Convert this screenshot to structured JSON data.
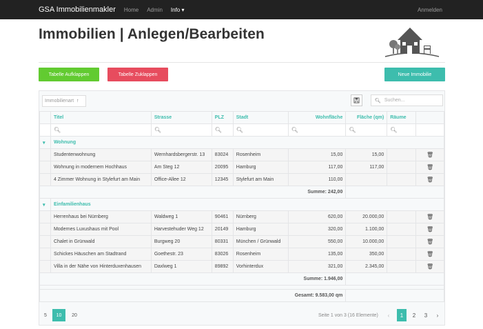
{
  "navbar": {
    "brand": "GSA Immobilienmakler",
    "links": [
      "Home",
      "Admin",
      "Info ▾"
    ],
    "login": "Anmelden"
  },
  "page": {
    "title": "Immobilien | Anlegen/Bearbeiten"
  },
  "buttons": {
    "expand": "Tabelle Aufklappen",
    "collapse": "Tabelle Zuklappen",
    "new": "Neue Immobilie"
  },
  "toolbar": {
    "group_sort": "Immobilienart",
    "group_sort_icon": "↑",
    "export_icon": "save-icon",
    "search_placeholder": "Suchen..."
  },
  "table": {
    "columns": [
      "Titel",
      "Strasse",
      "PLZ",
      "Stadt",
      "Wohnfläche",
      "Fläche (qm)",
      "Räume"
    ],
    "groups": [
      {
        "name": "Wohnung",
        "rows": [
          [
            "Studentenwohnung",
            "Wernhardsbergerstr. 13",
            "83024",
            "Rosenheim",
            "15,00",
            "15,00",
            ""
          ],
          [
            "Wohnung in modernem Hochhaus",
            "Am Steg 12",
            "20095",
            "Hamburg",
            "117,00",
            "117,00",
            ""
          ],
          [
            "4 Zimmer Wohnung in Stylefurt am Main",
            "Office-Allee 12",
            "12345",
            "Stylefurt am Main",
            "110,00",
            "",
            ""
          ]
        ],
        "sum": "Summe: 242,00"
      },
      {
        "name": "Einfamilienhaus",
        "rows": [
          [
            "Herrenhaus bei Nürnberg",
            "Waldweg 1",
            "90461",
            "Nürnberg",
            "620,00",
            "20.000,00",
            ""
          ],
          [
            "Modernes Luxushaus mit Pool",
            "Harvestehuder Weg 12",
            "20149",
            "Hamburg",
            "320,00",
            "1.100,00",
            ""
          ],
          [
            "Chalet in Grünwald",
            "Burgweg 20",
            "80331",
            "München / Grünwald",
            "550,00",
            "10.000,00",
            ""
          ],
          [
            "Schickes Häuschen am Stadtrand",
            "Goethestr. 23",
            "83026",
            "Rosenheim",
            "135,00",
            "350,00",
            ""
          ],
          [
            "Villa in der Nähe von Hinterduxenhausen",
            "Daxlweg 1",
            "89892",
            "Vorhinterdux",
            "321,00",
            "2.345,00",
            ""
          ]
        ],
        "sum": "Summe: 1.946,00"
      }
    ],
    "total": "Gesamt: 9.583,00 qm"
  },
  "footer": {
    "page_sizes": [
      "5",
      "10",
      "20"
    ],
    "active_size": "10",
    "page_info": "Seite 1 von 3 (16 Elemente)",
    "pages": [
      "1",
      "2",
      "3"
    ],
    "active_page": "1",
    "prev_icon": "‹",
    "next_icon": "›"
  },
  "colors": {
    "accent": "#3dbdad",
    "green": "#62cb31",
    "red": "#e74c5e",
    "navbar": "#222222"
  }
}
